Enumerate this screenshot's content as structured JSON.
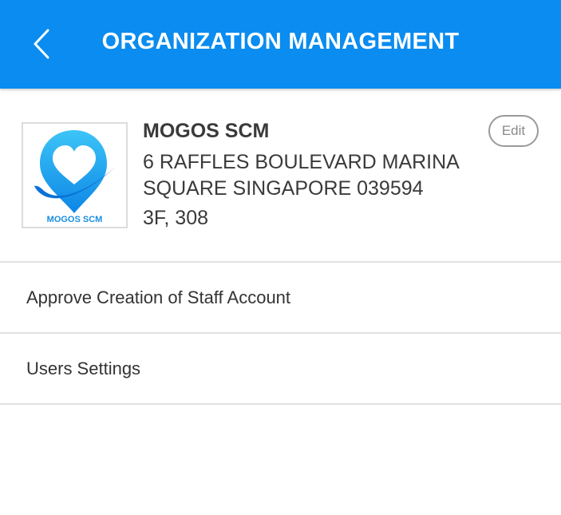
{
  "header": {
    "title": "ORGANIZATION MANAGEMENT",
    "back_icon": "chevron-left-icon",
    "background": "#0a8cf0"
  },
  "organization": {
    "name": "MOGOS SCM",
    "address": "6 RAFFLES BOULEVARD MARINA SQUARE SINGAPORE 039594",
    "floor": "3F, 308",
    "logo_text": "MOGOS SCM",
    "edit_label": "Edit"
  },
  "menu": {
    "items": [
      {
        "label": "Approve Creation of Staff Account"
      },
      {
        "label": "Users Settings"
      }
    ]
  }
}
